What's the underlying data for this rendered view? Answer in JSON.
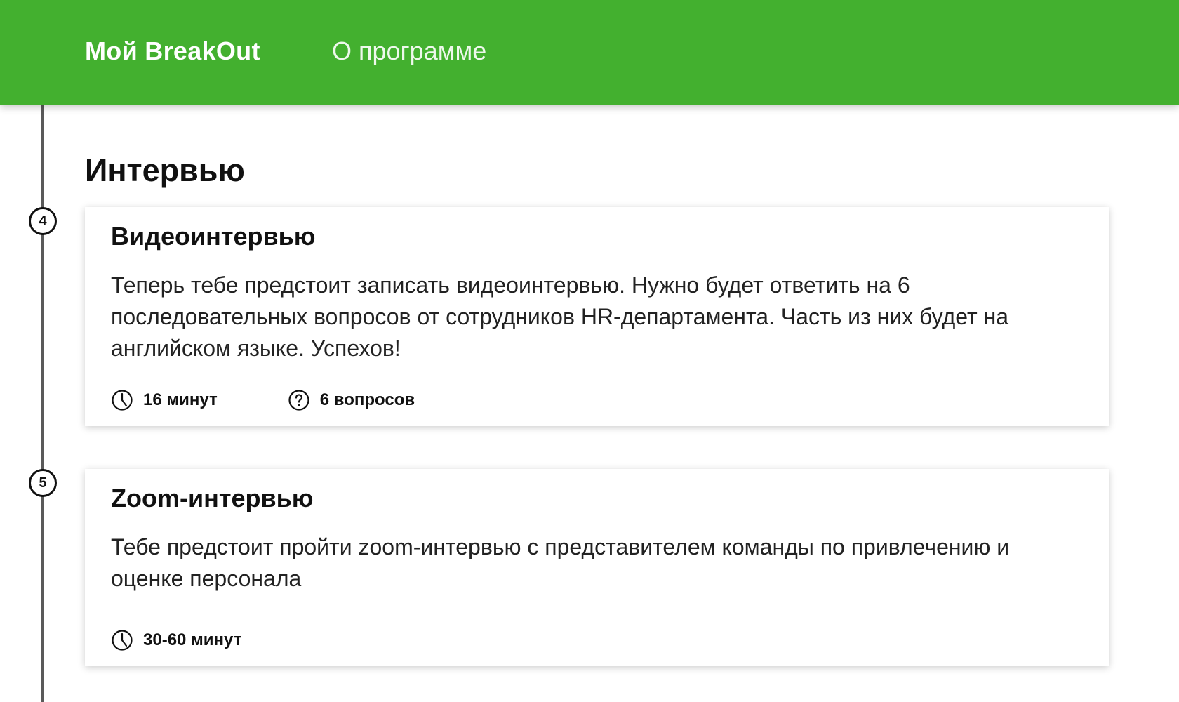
{
  "header": {
    "brand_label": "Мой BreakOut",
    "about_label": "О программе",
    "background_color": "#43b02f"
  },
  "section": {
    "title": "Интервью"
  },
  "steps": [
    {
      "number": "4",
      "title": "Видеоинтервью",
      "description": "Теперь тебе предстоит записать видеоинтервью. Нужно будет ответить на 6 последовательных вопросов от сотрудников HR-департамента. Часть из них будет на английском языке. Успехов!",
      "duration": "16 минут",
      "duration_icon": "clock-icon",
      "questions": "6 вопросов",
      "questions_icon": "question-circle-icon"
    },
    {
      "number": "5",
      "title": "Zoom-интервью",
      "description": "Тебе предстоит пройти zoom-интервью с представителем команды по привлечению и оценке персонала",
      "duration": "30-60 минут",
      "duration_icon": "clock-icon"
    }
  ]
}
